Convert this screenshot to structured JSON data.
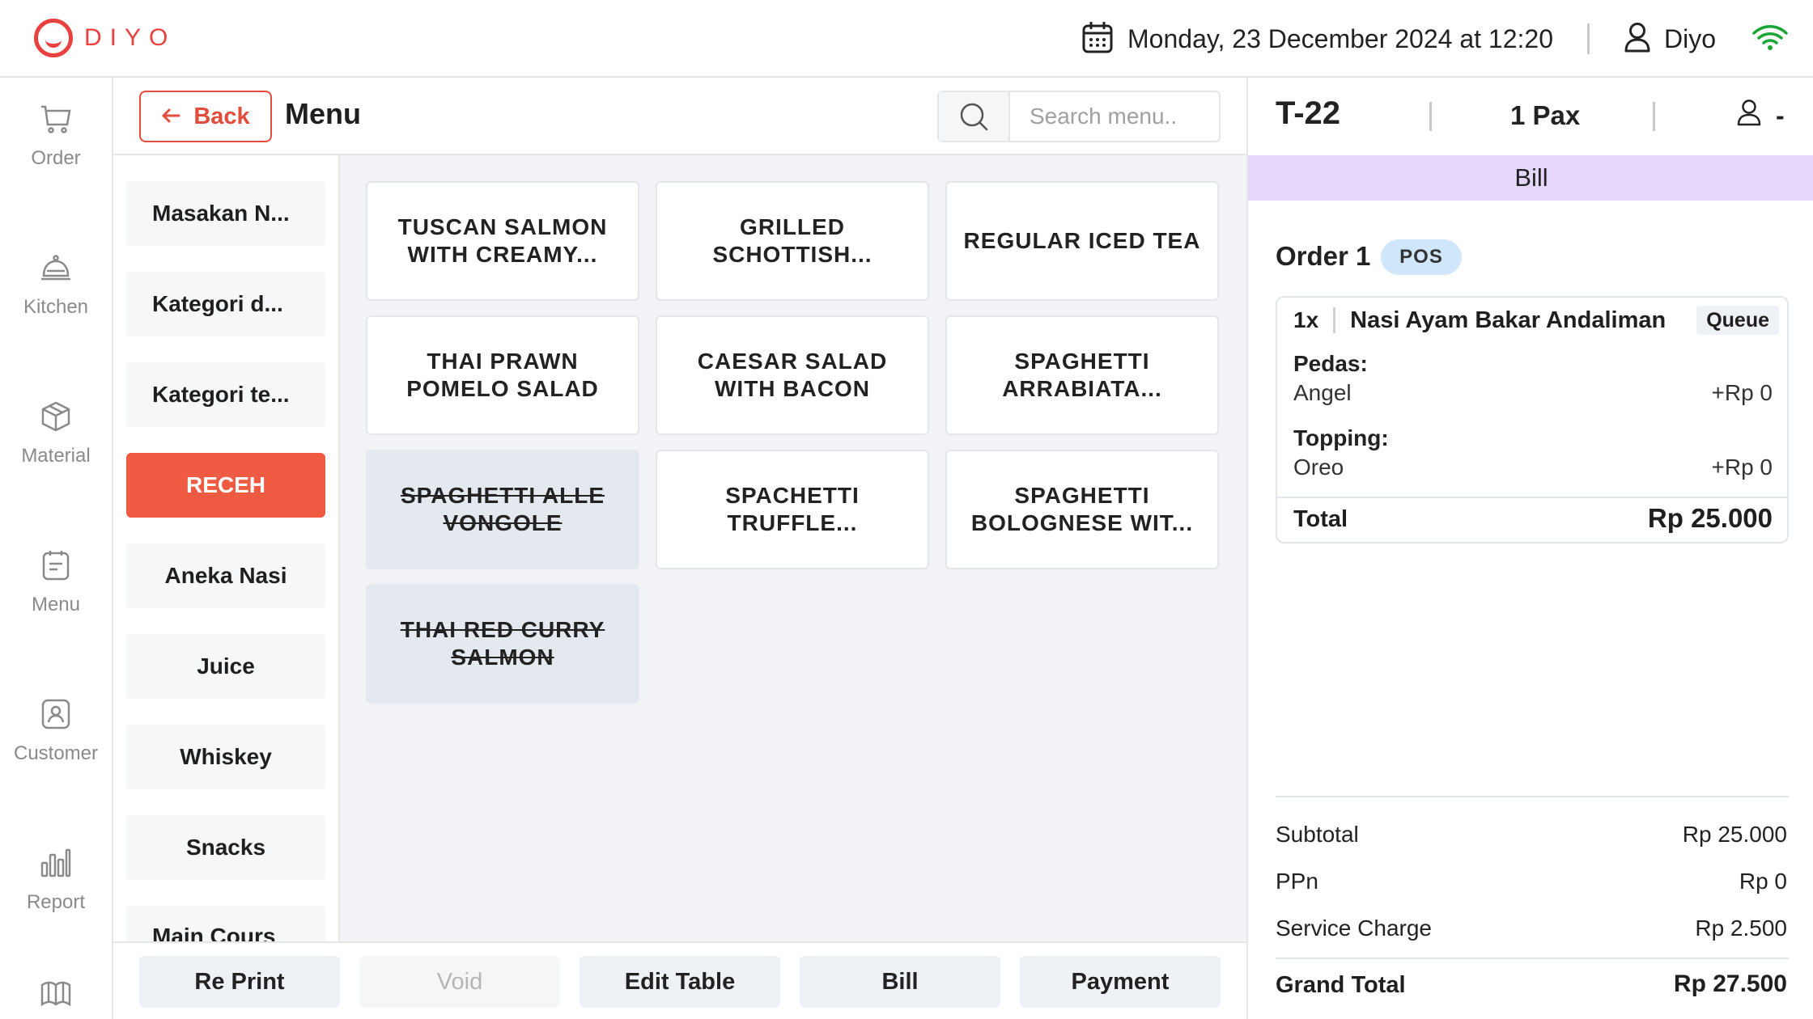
{
  "header": {
    "logo_text": "DIYO",
    "datetime": "Monday, 23 December 2024 at 12:20",
    "user_name": "Diyo",
    "icons": [
      "calendar-icon",
      "user-icon",
      "wifi-icon"
    ]
  },
  "nav": {
    "items": [
      {
        "label": "Order",
        "icon": "cart-icon"
      },
      {
        "label": "Kitchen",
        "icon": "cloche-icon"
      },
      {
        "label": "Material",
        "icon": "box-icon"
      },
      {
        "label": "Menu",
        "icon": "menu-list-icon"
      },
      {
        "label": "Customer",
        "icon": "customer-icon"
      },
      {
        "label": "Report",
        "icon": "bar-chart-icon"
      }
    ]
  },
  "menu_header": {
    "back_label": "Back",
    "title": "Menu",
    "search_placeholder": "Search menu.."
  },
  "categories": [
    {
      "label": "Masakan N...",
      "active": false
    },
    {
      "label": "Kategori d...",
      "active": false
    },
    {
      "label": "Kategori te...",
      "active": false
    },
    {
      "label": "RECEH",
      "active": true
    },
    {
      "label": "Aneka Nasi",
      "active": false
    },
    {
      "label": "Juice",
      "active": false
    },
    {
      "label": "Whiskey",
      "active": false
    },
    {
      "label": "Snacks",
      "active": false
    },
    {
      "label": "Main Cours",
      "active": false
    }
  ],
  "menu_items": [
    {
      "line1": "TUSCAN SALMON",
      "line2": "WITH CREAMY...",
      "available": true
    },
    {
      "line1": "GRILLED",
      "line2": "SCHOTTISH...",
      "available": true
    },
    {
      "line1": "REGULAR ICED TEA",
      "line2": "",
      "available": true
    },
    {
      "line1": "THAI PRAWN",
      "line2": "POMELO SALAD",
      "available": true
    },
    {
      "line1": "CAESAR SALAD",
      "line2": "WITH BACON",
      "available": true
    },
    {
      "line1": "SPAGHETTI",
      "line2": "ARRABIATA...",
      "available": true
    },
    {
      "line1": "SPAGHETTI ALLE",
      "line2": "VONGOLE",
      "available": false
    },
    {
      "line1": "SPACHETTI",
      "line2": "TRUFFLE...",
      "available": true
    },
    {
      "line1": "SPAGHETTI",
      "line2": "BOLOGNESE WIT...",
      "available": true
    },
    {
      "line1": "THAI RED CURRY",
      "line2": "SALMON",
      "available": false
    }
  ],
  "actions": {
    "reprint": "Re Print",
    "void": "Void",
    "edit_table": "Edit Table",
    "bill": "Bill",
    "payment": "Payment"
  },
  "order_panel": {
    "table": "T-22",
    "pax": "1 Pax",
    "guest": "-",
    "tab_label": "Bill",
    "order_title": "Order 1",
    "order_badge": "POS",
    "item": {
      "qty": "1x",
      "name": "Nasi Ayam Bakar Andaliman",
      "status": "Queue",
      "modifiers": [
        {
          "group": "Pedas:",
          "option": "Angel",
          "price": "+Rp 0"
        },
        {
          "group": "Topping:",
          "option": "Oreo",
          "price": "+Rp 0"
        }
      ],
      "total_label": "Total",
      "total_value": "Rp 25.000"
    },
    "summary": {
      "subtotal_label": "Subtotal",
      "subtotal_value": "Rp 25.000",
      "ppn_label": "PPn",
      "ppn_value": "Rp 0",
      "service_label": "Service Charge",
      "service_value": "Rp 2.500",
      "grand_label": "Grand Total",
      "grand_value": "Rp 27.500"
    }
  },
  "colors": {
    "brand": "#e8413f",
    "active_category": "#ef5a42",
    "bill_tab": "#e5d6fb",
    "pos_badge": "#cfe6fb",
    "wifi": "#19a535"
  }
}
